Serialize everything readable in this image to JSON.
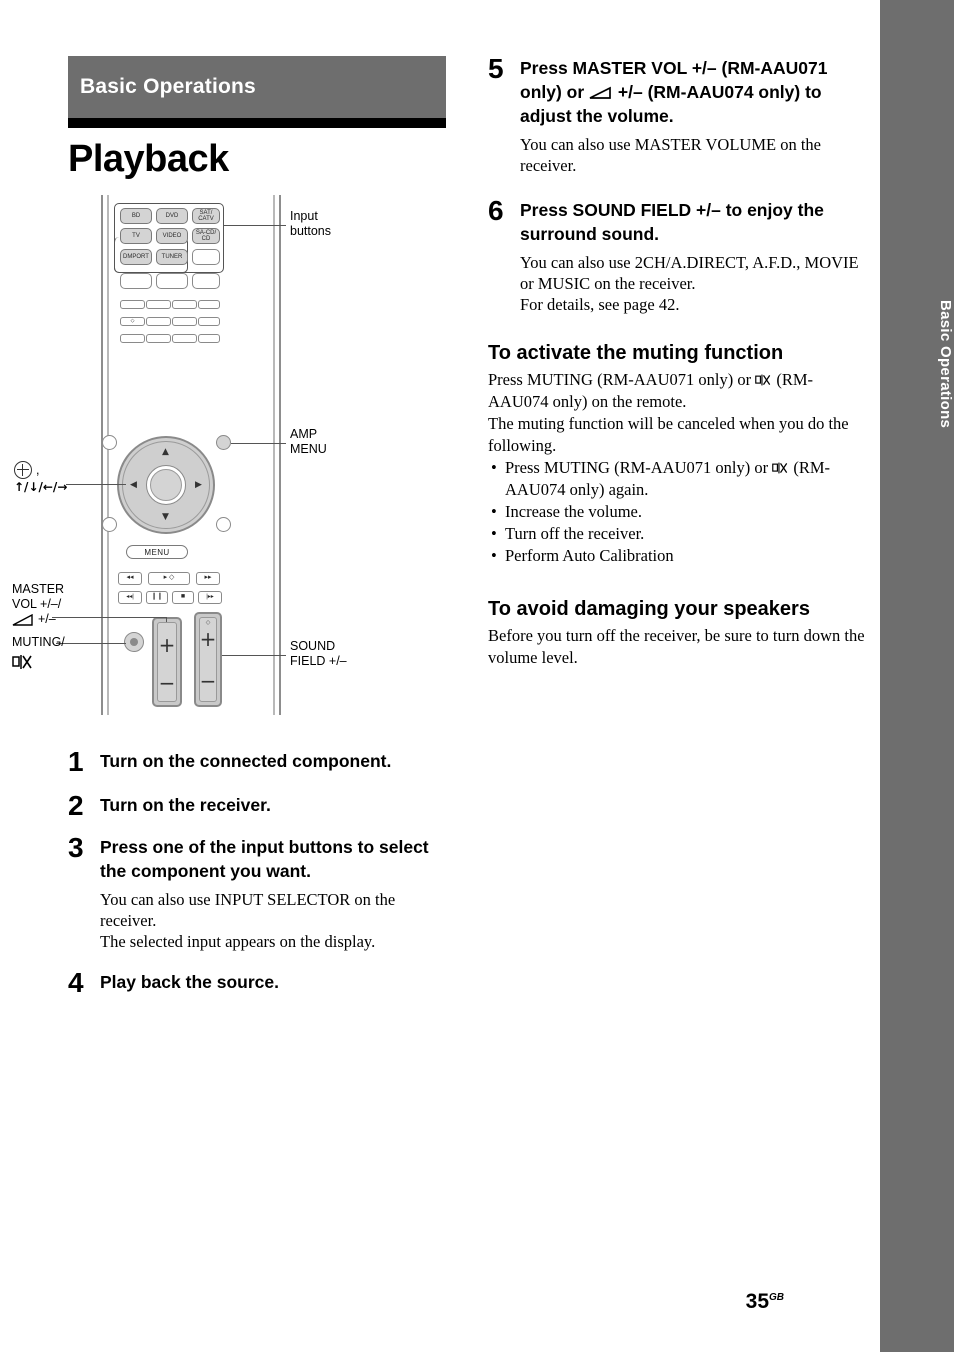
{
  "side_tab": {
    "label": "Basic Operations"
  },
  "chapter": {
    "band_title": "Basic Operations",
    "page_title": "Playback"
  },
  "figure": {
    "remote_buttons": {
      "inputs": [
        "BD",
        "DVD",
        "SAT/ CATV",
        "TV",
        "VIDEO",
        "SA-CD/ CD",
        "DMPORT",
        "TUNER"
      ],
      "menu_label": "MENU"
    },
    "callouts": {
      "input_buttons": "Input\nbuttons",
      "input_buttons_line1": "Input",
      "input_buttons_line2": "buttons",
      "amp_menu_line1": "AMP",
      "amp_menu_line2": "MENU",
      "dpad_line1": "⊕ ,",
      "dpad_line2": "↑/↓/←/→",
      "master_vol_line1": "MASTER",
      "master_vol_line2": "VOL +/–/",
      "master_vol_line3": "+/–",
      "muting_line1": "MUTING/",
      "sound_field_line1": "SOUND",
      "sound_field_line2": "FIELD +/–"
    }
  },
  "steps": [
    {
      "num": "1",
      "head": "Turn on the connected component.",
      "sub": ""
    },
    {
      "num": "2",
      "head": "Turn on the receiver.",
      "sub": ""
    },
    {
      "num": "3",
      "head": "Press one of the input buttons to select the component you want.",
      "sub": "You can also use INPUT SELECTOR on the receiver.\nThe selected input appears on the display."
    },
    {
      "num": "4",
      "head": "Play back the source.",
      "sub": ""
    },
    {
      "num": "5",
      "head_part1": "Press MASTER VOL +/– (RM-AAU071 only) or ",
      "head_part2": " +/– (RM-AAU074 only) to adjust the volume.",
      "sub": "You can also use MASTER VOLUME on the receiver."
    },
    {
      "num": "6",
      "head": "Press SOUND FIELD +/– to enjoy the surround sound.",
      "sub": "You can also use 2CH/A.DIRECT, A.F.D., MOVIE or MUSIC on the receiver.\nFor details, see page 42."
    }
  ],
  "sections": [
    {
      "heading": "To activate the muting function",
      "para_a": "Press MUTING (RM-AAU071 only) or ",
      "para_b": " (RM-AAU074 only) on the remote.",
      "para_c": "The muting function will be canceled when you do the following.",
      "bullets": [
        {
          "a": "Press MUTING (RM-AAU071 only) or ",
          "b": " (RM-AAU074 only) again."
        },
        {
          "a": "Increase the volume.",
          "b": ""
        },
        {
          "a": "Turn off the receiver.",
          "b": ""
        },
        {
          "a": "Perform Auto Calibration",
          "b": ""
        }
      ]
    },
    {
      "heading": "To avoid damaging your speakers",
      "body": "Before you turn off the receiver, be sure to turn down the volume level."
    }
  ],
  "folio": {
    "number": "35",
    "suffix": "GB"
  },
  "colors": {
    "band_gray": "#6e6e6e",
    "rule_black": "#000000",
    "button_gray": "#d4d4d4"
  }
}
